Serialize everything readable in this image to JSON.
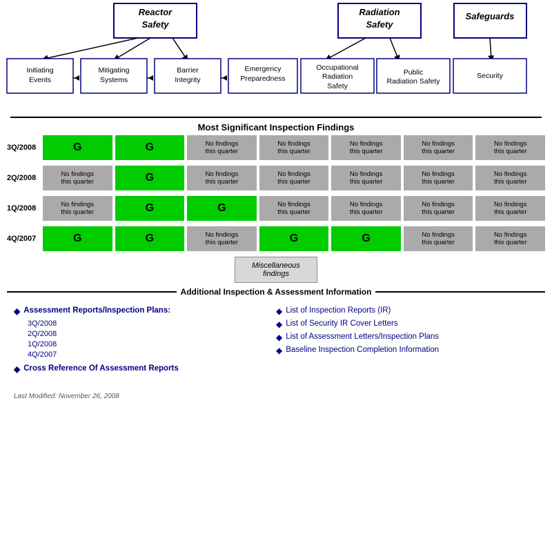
{
  "diagram": {
    "top_categories": [
      {
        "id": "reactor-safety",
        "label": "Reactor\nSafety"
      },
      {
        "id": "radiation-safety",
        "label": "Radiation\nSafety"
      },
      {
        "id": "safeguards",
        "label": "Safeguards"
      }
    ],
    "sub_categories": [
      {
        "id": "initiating-events",
        "label": "Initiating\nEvents"
      },
      {
        "id": "mitigating-systems",
        "label": "Mitigating\nSystems"
      },
      {
        "id": "barrier-integrity",
        "label": "Barrier\nIntegrity"
      },
      {
        "id": "emergency-preparedness",
        "label": "Emergency\nPreparedness"
      },
      {
        "id": "occupational-radiation-safety",
        "label": "Occupational\nRadiation\nSafety"
      },
      {
        "id": "public-radiation-safety",
        "label": "Public\nRadiation\nSafety"
      },
      {
        "id": "security",
        "label": "Security"
      }
    ]
  },
  "findings": {
    "header": "Most Significant Inspection Findings",
    "no_findings_label": "No findings\nthis quarter",
    "green_label": "G",
    "rows": [
      {
        "quarter": "3Q/2008",
        "cells": [
          "green",
          "green",
          "gray",
          "gray",
          "gray",
          "gray",
          "gray"
        ]
      },
      {
        "quarter": "2Q/2008",
        "cells": [
          "gray",
          "green",
          "gray",
          "gray",
          "gray",
          "gray",
          "gray"
        ]
      },
      {
        "quarter": "1Q/2008",
        "cells": [
          "gray",
          "green",
          "green",
          "gray",
          "gray",
          "gray",
          "gray"
        ]
      },
      {
        "quarter": "4Q/2007",
        "cells": [
          "green",
          "green",
          "gray",
          "green",
          "green",
          "gray",
          "gray"
        ]
      }
    ]
  },
  "misc": {
    "label": "Miscellaneous\nfindings"
  },
  "additional": {
    "header": "Additional Inspection & Assessment Information"
  },
  "links_left": {
    "main_label": "Assessment Reports/Inspection Plans:",
    "quarters": [
      "3Q/2008",
      "2Q/2008",
      "1Q/2008",
      "4Q/2007"
    ],
    "cross_ref_label": "Cross Reference Of Assessment Reports"
  },
  "links_right": [
    "List of Inspection Reports (IR)",
    "List of Security IR Cover Letters",
    "List of Assessment Letters/Inspection Plans",
    "Baseline Inspection Completion Information"
  ],
  "footer": {
    "text": "Last Modified:  November 26, 2008"
  }
}
